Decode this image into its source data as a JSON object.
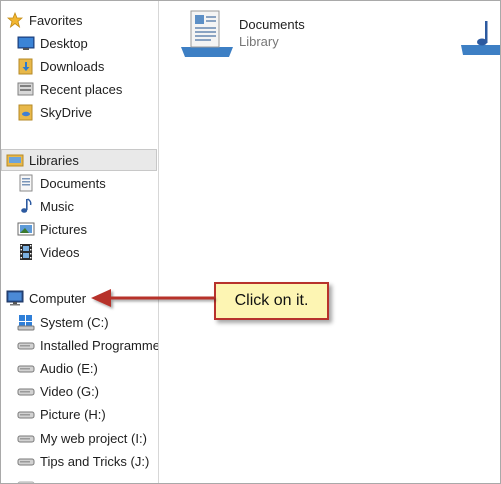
{
  "favorites": {
    "header": "Favorites",
    "items": [
      "Desktop",
      "Downloads",
      "Recent places",
      "SkyDrive"
    ]
  },
  "libraries": {
    "header": "Libraries",
    "items": [
      "Documents",
      "Music",
      "Pictures",
      "Videos"
    ]
  },
  "computer": {
    "header": "Computer",
    "drives": [
      "System (C:)",
      "Installed Programme",
      "Audio (E:)",
      "Video (G:)",
      "Picture (H:)",
      "My web project (I:)",
      "Tips and Tricks  (J:)"
    ]
  },
  "content": {
    "library_tile": {
      "name": "Documents",
      "type": "Library"
    }
  },
  "annotation": {
    "text": "Click on it.",
    "border_color": "#b7322c",
    "fill_color": "#fdf5b3"
  },
  "colors": {
    "selection_bg": "#e9e9e9",
    "folder_yellow": "#e8b84a"
  }
}
